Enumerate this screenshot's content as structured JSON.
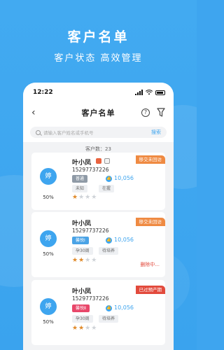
{
  "promo": {
    "title": "客户名单",
    "subtitle": "客户状态 高效管理"
  },
  "status": {
    "time": "12:22"
  },
  "nav": {
    "title": "客户名单",
    "back": "‹",
    "help": "?"
  },
  "search": {
    "placeholder": "请输入客户姓名或手机号",
    "button": "搜索"
  },
  "count_label": "客户数：23",
  "customers": [
    {
      "avatar": "婷",
      "percent": "50%",
      "name": "叶小凤",
      "phone": "15297737226",
      "level": "普通",
      "score": "10,056",
      "tags": [
        "未知",
        "在握"
      ],
      "stars": 1,
      "status": "移交未回访"
    },
    {
      "avatar": "婷",
      "percent": "50%",
      "name": "叶小凤",
      "phone": "15297737226",
      "level": "馨悦Ⅰ",
      "score": "10,056",
      "tags": [
        "孕30周",
        "待培养"
      ],
      "stars": 2,
      "status": "移交未回访",
      "extra": "删除中..."
    },
    {
      "avatar": "婷",
      "percent": "50%",
      "name": "叶小凤",
      "phone": "15297737226",
      "level": "馨悦Ⅱ",
      "score": "10,056",
      "tags": [
        "孕30周",
        "待培养"
      ],
      "stars": 2,
      "status": "已过预产期"
    }
  ],
  "colors": {
    "accent": "#3ea5ef",
    "status_orange": "#ef8a42",
    "status_red": "#e24a3c",
    "star": "#e08a2a"
  }
}
